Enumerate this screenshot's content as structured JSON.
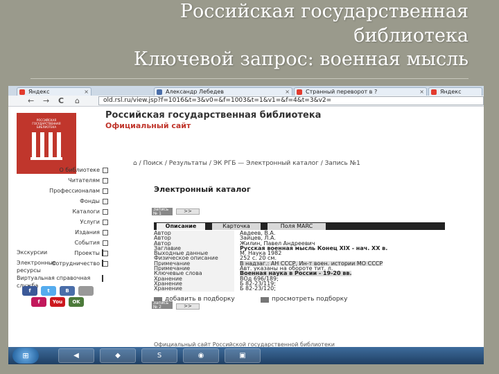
{
  "slide": {
    "title_line1": "Российская государственная",
    "title_line2": "библиотека",
    "title_line3": "Ключевой запрос: военная мысль"
  },
  "browser": {
    "tabs": [
      {
        "label": "Яндекс",
        "favicon_color": "#e23b2e"
      },
      {
        "label": "Александр Лебедев",
        "favicon_color": "#4a6ea9"
      },
      {
        "label": "Странный переворот в ?",
        "favicon_color": "#e23b2e"
      },
      {
        "label": "Яндекс",
        "favicon_color": "#e23b2e"
      }
    ],
    "tab_close": "×",
    "back": "←",
    "forward": "→",
    "reload": "C",
    "home": "⌂",
    "url": "old.rsl.ru/view.jsp?f=1016&t=3&v0=&f=1003&t=1&v1=&f=4&t=3&v2="
  },
  "site": {
    "logo_text": "РОССИЙСКАЯ ГОСУДАРСТВЕННАЯ БИБЛИОТЕКА",
    "logo_color": "#c0362c",
    "name": "Российская государственная библиотека",
    "subtitle": "Официальный сайт",
    "menu": [
      "О библиотеке",
      "Читателям",
      "Профессионалам",
      "Фонды",
      "Каталоги",
      "Услуги",
      "Издания",
      "События",
      "Проекты",
      "Сотрудничество"
    ],
    "links": [
      "Экскурсии",
      "Электронные ресурсы",
      "Виртуальная справочная служба"
    ],
    "social": [
      "f",
      "t",
      "В",
      "f",
      "You",
      "OK"
    ]
  },
  "catalog": {
    "breadcrumb": "Поиск / Результаты / ЭК РГБ  —  Электронный каталог / Запись №1",
    "title": "Электронный каталог",
    "record_label": "Запись № 1",
    "record2_label": "Запись № 2",
    "nav_next": ">>",
    "tabs": [
      "Описание",
      "Карточка",
      "Поля MARC"
    ],
    "fields": [
      {
        "k": "Автор",
        "v": "Авдеев, В.А."
      },
      {
        "k": "Автор",
        "v": "Зайцев, Л.А."
      },
      {
        "k": "Автор",
        "v": "Жилин, Павел Андреевич"
      },
      {
        "k": "Заглавие",
        "v": "Русская военная мысль Конец XIX - нач. XX в."
      },
      {
        "k": "Выходные данные",
        "v": "М. Наука 1982"
      },
      {
        "k": "Физическое описание",
        "v": "252 с. 20 см."
      },
      {
        "k": "Примечание",
        "v": "В надзаг.: АН СССР, Ин-т воен. истории МО СССР"
      },
      {
        "k": "Примечание",
        "v": "Авт. указаны на обороте тит. л."
      },
      {
        "k": "Ключевые слова",
        "v": "Военная наука в России - 19-20 вв."
      },
      {
        "k": "Хранение",
        "v": "ВОд 696/189;"
      },
      {
        "k": "Хранение",
        "v": "Б 82-23/119;"
      },
      {
        "k": "Хранение",
        "v": "Б 82-23/120;"
      }
    ],
    "add_label": "добавить в подборку",
    "view_label": "просмотреть подборку",
    "footer": "Официальный сайт Российской государственной библиотеки"
  },
  "taskbar": {
    "start": "⊞",
    "items": [
      "◀",
      "◆",
      "S",
      "◉",
      "▣"
    ]
  }
}
